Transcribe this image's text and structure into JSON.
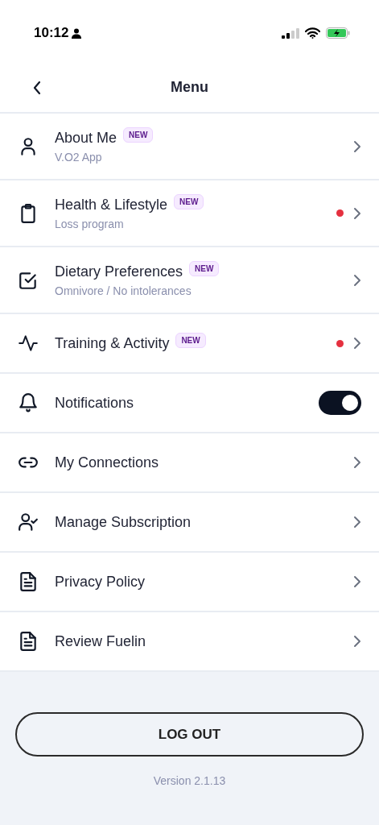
{
  "status_bar": {
    "time": "10:12"
  },
  "header": {
    "title": "Menu"
  },
  "items": [
    {
      "kind": "nav",
      "label": "About Me",
      "badge": "NEW",
      "subtitle": "V.O2 App",
      "alert": false
    },
    {
      "kind": "nav",
      "label": "Health & Lifestyle",
      "badge": "NEW",
      "subtitle": "Loss program",
      "alert": true
    },
    {
      "kind": "nav",
      "label": "Dietary Preferences",
      "badge": "NEW",
      "subtitle": "Omnivore / No intolerances",
      "alert": false
    },
    {
      "kind": "nav",
      "label": "Training & Activity",
      "badge": "NEW",
      "alert": true
    },
    {
      "kind": "toggle",
      "label": "Notifications",
      "on": true
    },
    {
      "kind": "nav",
      "label": "My Connections",
      "alert": false
    },
    {
      "kind": "nav",
      "label": "Manage Subscription",
      "alert": false
    },
    {
      "kind": "nav",
      "label": "Privacy Policy",
      "alert": false
    },
    {
      "kind": "nav",
      "label": "Review Fuelin",
      "alert": false
    }
  ],
  "footer": {
    "button": "LOG OUT",
    "version": "Version 2.1.13"
  }
}
